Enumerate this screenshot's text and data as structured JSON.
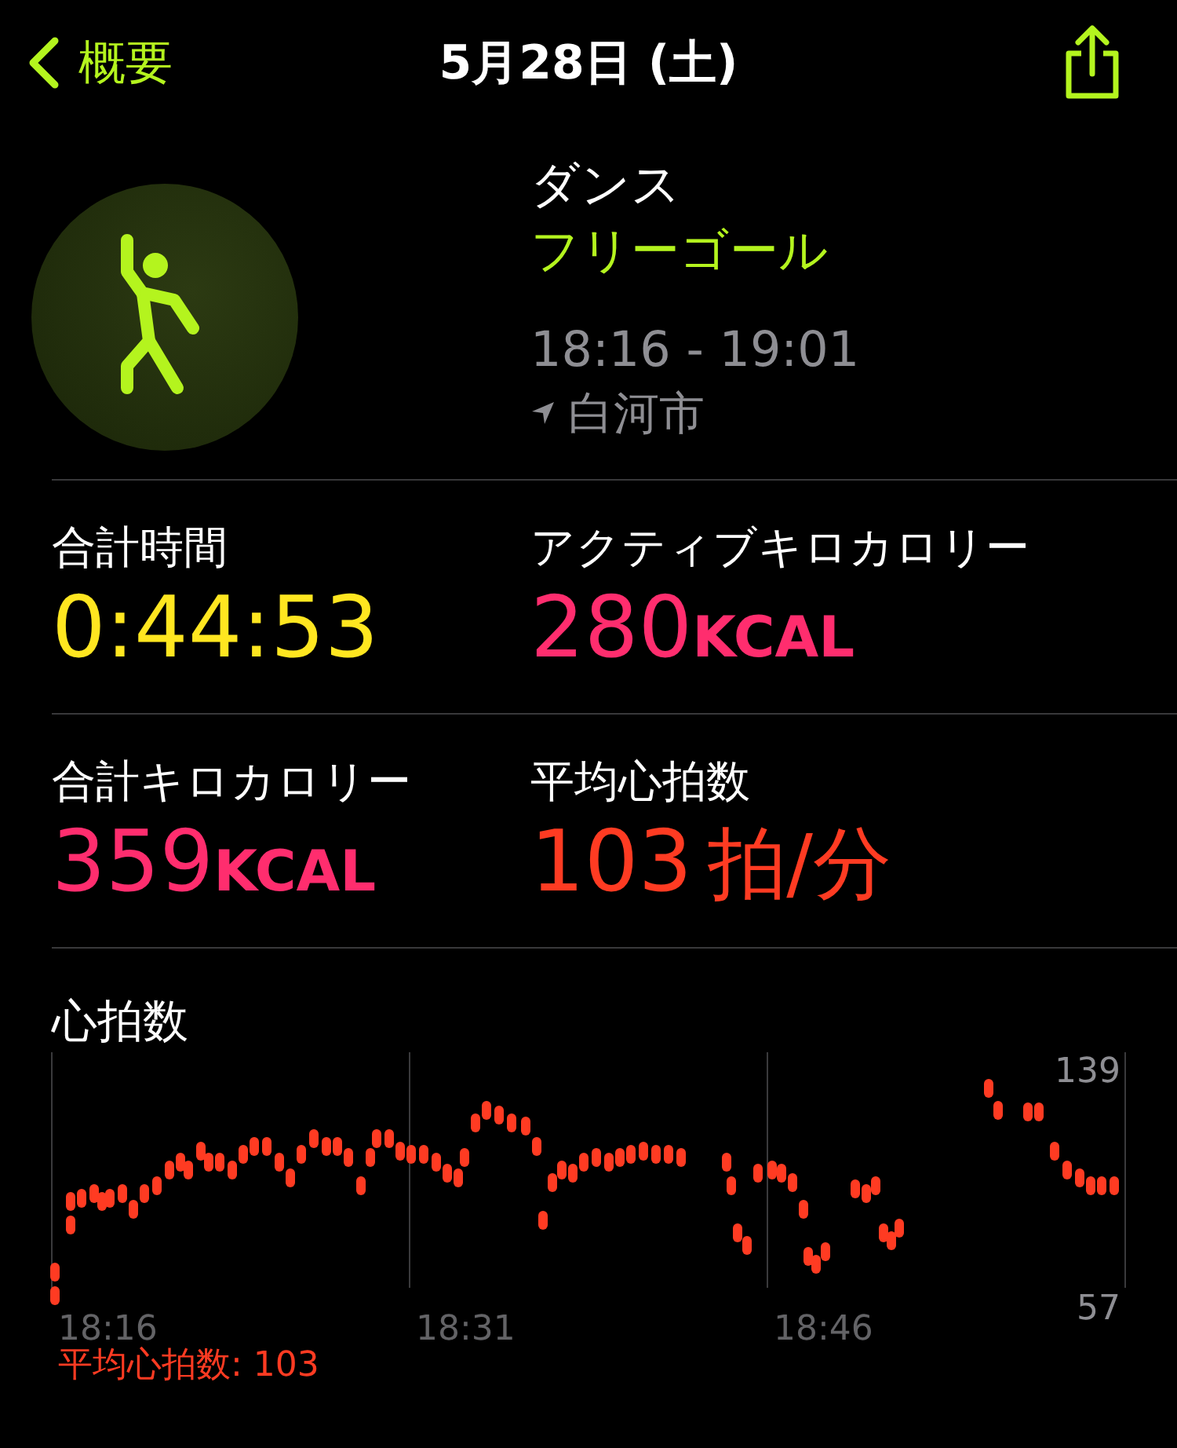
{
  "nav": {
    "back_label": "概要",
    "title": "5月28日 (土)"
  },
  "workout": {
    "type": "ダンス",
    "goal": "フリーゴール",
    "time_range": "18:16 - 19:01",
    "location": "白河市"
  },
  "metrics": [
    {
      "label": "合計時間",
      "value": "0:44:53",
      "color": "#ffe620"
    },
    {
      "label": "アクティブキロカロリー",
      "value": "280",
      "unit": "KCAL",
      "color": "#ff2d6e"
    },
    {
      "label": "合計キロカロリー",
      "value": "359",
      "unit": "KCAL",
      "color": "#ff2d6e"
    },
    {
      "label": "平均心拍数",
      "value": "103",
      "unit": "拍/分",
      "color": "#ff3b22"
    }
  ],
  "heart_rate": {
    "title": "心拍数",
    "max_label": "139",
    "min_label": "57",
    "time_labels": [
      "18:16",
      "18:31",
      "18:46"
    ],
    "average_label": "平均心拍数: 103"
  }
}
